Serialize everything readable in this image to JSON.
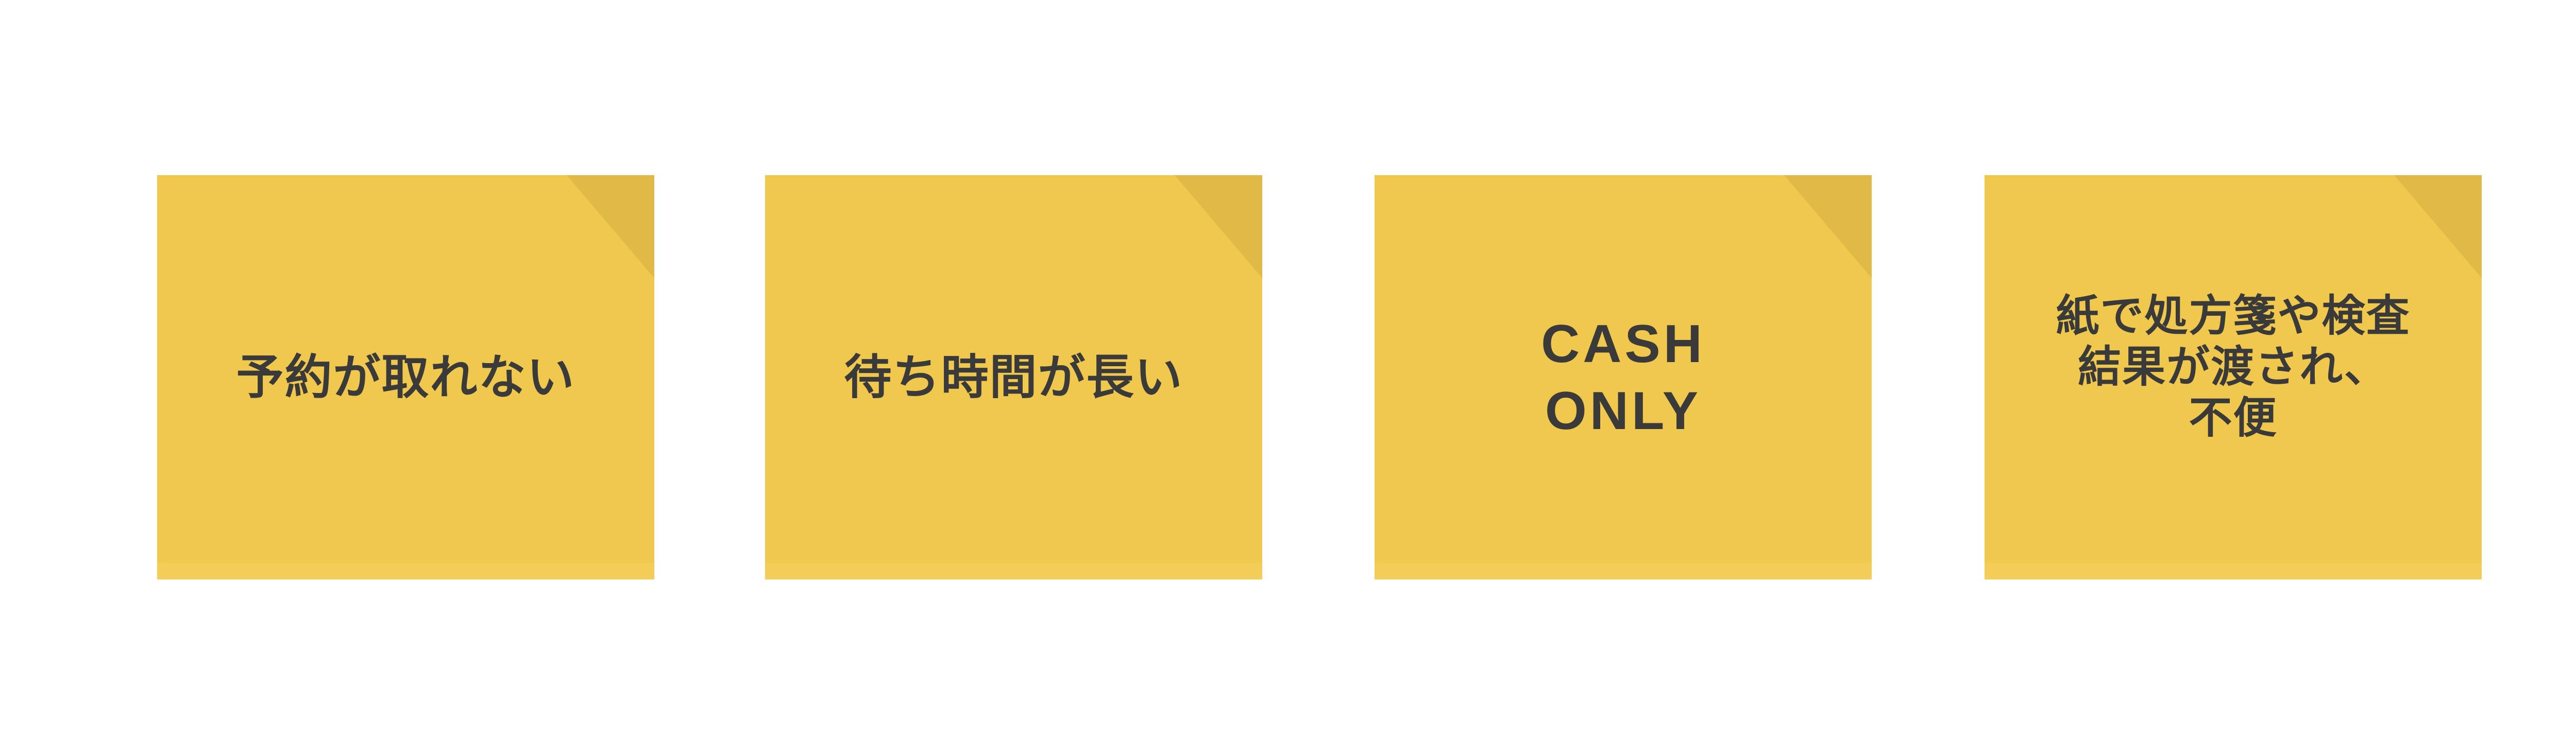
{
  "notes": [
    {
      "text": "予約が取れない",
      "color": "#f0c84e"
    },
    {
      "text": "待ち時間が長い",
      "color": "#f0c84e"
    },
    {
      "text": "CASH\nONLY",
      "color": "#f0c84e"
    },
    {
      "text": "紙で処方箋や検査\n結果が渡され、\n不便",
      "color": "#f0c84e"
    }
  ],
  "colors": {
    "note": "#f0c84e",
    "fold": "#e0b946",
    "text": "#3a3a3a",
    "background": "#ffffff"
  }
}
